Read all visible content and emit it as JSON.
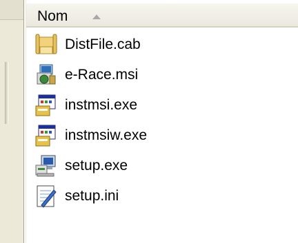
{
  "header": {
    "column_label": "Nom"
  },
  "files": [
    {
      "name": "DistFile.cab",
      "icon": "cabinet-archive-icon"
    },
    {
      "name": "e-Race.msi",
      "icon": "installer-package-icon"
    },
    {
      "name": "instmsi.exe",
      "icon": "setup-program-icon"
    },
    {
      "name": "instmsiw.exe",
      "icon": "setup-program-icon"
    },
    {
      "name": "setup.exe",
      "icon": "setup-computer-icon"
    },
    {
      "name": "setup.ini",
      "icon": "config-file-icon"
    }
  ]
}
